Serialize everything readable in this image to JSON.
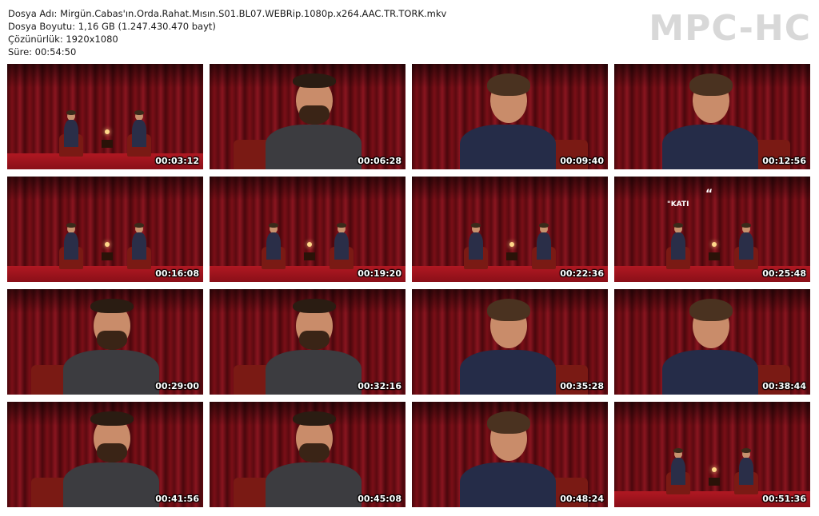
{
  "info": {
    "filename": "Dosya Adı: Mirgün.Cabas'ın.Orda.Rahat.Mısın.S01.BL07.WEBRip.1080p.x264.AAC.TR.TORK.mkv",
    "filesize": "Dosya Boyutu: 1,16 GB (1.247.430.470 bayt)",
    "resolution": "Çözünürlük: 1920x1080",
    "duration": "Süre: 00:54:50"
  },
  "logo": "MPC-HC",
  "thumbnails": [
    {
      "timestamp": "00:03:12",
      "shot": "wide"
    },
    {
      "timestamp": "00:06:28",
      "shot": "close-bald"
    },
    {
      "timestamp": "00:09:40",
      "shot": "close-curly"
    },
    {
      "timestamp": "00:12:56",
      "shot": "close-curly"
    },
    {
      "timestamp": "00:16:08",
      "shot": "wide"
    },
    {
      "timestamp": "00:19:20",
      "shot": "wide"
    },
    {
      "timestamp": "00:22:36",
      "shot": "wide"
    },
    {
      "timestamp": "00:25:48",
      "shot": "wide"
    },
    {
      "timestamp": "00:29:00",
      "shot": "close-bald"
    },
    {
      "timestamp": "00:32:16",
      "shot": "close-bald"
    },
    {
      "timestamp": "00:35:28",
      "shot": "close-curly"
    },
    {
      "timestamp": "00:38:44",
      "shot": "close-curly"
    },
    {
      "timestamp": "00:41:56",
      "shot": "close-bald"
    },
    {
      "timestamp": "00:45:08",
      "shot": "close-bald"
    },
    {
      "timestamp": "00:48:24",
      "shot": "close-curly"
    },
    {
      "timestamp": "00:51:36",
      "shot": "wide"
    }
  ],
  "overlay_text": {
    "watermark_a": "\"KATI",
    "watermark_b": "“"
  },
  "colors": {
    "curtain": "#7a0f17",
    "floor": "#b01822",
    "text": "#1a1a1a",
    "logo": "#d8d8d8"
  }
}
